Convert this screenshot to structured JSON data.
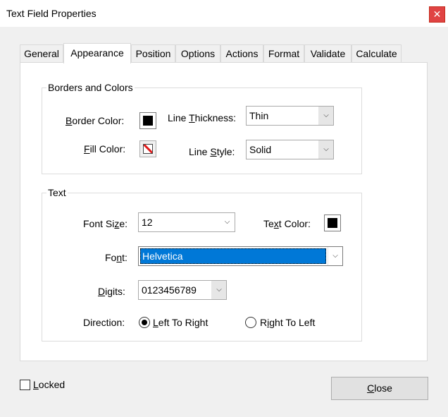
{
  "window": {
    "title": "Text Field Properties",
    "close_glyph": "✕"
  },
  "tabs": [
    {
      "label": "General"
    },
    {
      "label": "Appearance"
    },
    {
      "label": "Position"
    },
    {
      "label": "Options"
    },
    {
      "label": "Actions"
    },
    {
      "label": "Format"
    },
    {
      "label": "Validate"
    },
    {
      "label": "Calculate"
    }
  ],
  "active_tab": "Appearance",
  "borders_colors": {
    "group_label": "Borders and Colors",
    "border_color_label": {
      "pre": "",
      "accel": "B",
      "post": "order Color:"
    },
    "border_color": "#000000",
    "fill_color_label": {
      "pre": "",
      "accel": "F",
      "post": "ill Color:"
    },
    "fill_color": "none",
    "line_thickness_label": {
      "pre": "Line ",
      "accel": "T",
      "post": "hickness:"
    },
    "line_thickness_value": "Thin",
    "line_style_label": {
      "pre": "Line ",
      "accel": "S",
      "post": "tyle:"
    },
    "line_style_value": "Solid"
  },
  "text_group": {
    "group_label": "Text",
    "font_size_label": {
      "pre": "Font Si",
      "accel": "z",
      "post": "e:"
    },
    "font_size_value": "12",
    "text_color_label": {
      "pre": "Te",
      "accel": "x",
      "post": "t Color:"
    },
    "text_color": "#000000",
    "font_label": {
      "pre": "Fo",
      "accel": "n",
      "post": "t:"
    },
    "font_value": "Helvetica",
    "digits_label": {
      "pre": "",
      "accel": "D",
      "post": "igits:"
    },
    "digits_value": "0123456789",
    "direction_label": "Direction:",
    "ltr_label": {
      "pre": "",
      "accel": "L",
      "post": "eft To Right"
    },
    "rtl_label": {
      "pre": "R",
      "accel": "i",
      "post": "ght To Left"
    },
    "direction_selected": "Left To Right"
  },
  "footer": {
    "locked_label": {
      "pre": "",
      "accel": "L",
      "post": "ocked"
    },
    "locked_checked": false,
    "close_label": {
      "pre": "",
      "accel": "C",
      "post": "lose"
    }
  },
  "icons": {
    "dropdown": "chevron-down-icon",
    "close": "close-icon"
  },
  "colors": {
    "selection": "#0078d7",
    "close_button": "#e04343"
  }
}
